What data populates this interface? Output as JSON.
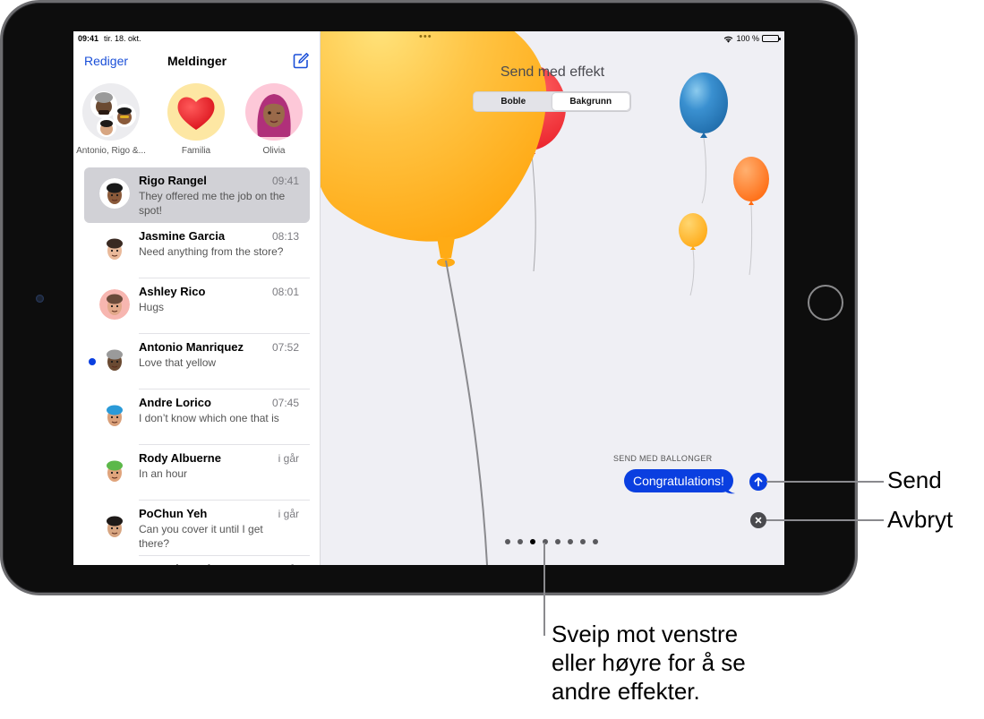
{
  "status_bar": {
    "time": "09:41",
    "date": "tir. 18. okt.",
    "more_dots": "•••",
    "battery_percent": "100 %",
    "battery_level": 1.0
  },
  "sidebar": {
    "edit_label": "Rediger",
    "title": "Meldinger",
    "compose_icon": "compose-icon",
    "pinned": [
      {
        "label": "Antonio, Rigo &...",
        "type": "group",
        "bg": "#ececef"
      },
      {
        "label": "Familia",
        "type": "heart",
        "bg": "#fde7a3"
      },
      {
        "label": "Olivia",
        "type": "memoji",
        "bg": "#fdc8d8"
      }
    ],
    "conversations": [
      {
        "name": "Rigo Rangel",
        "time": "09:41",
        "preview": "They offered me the job on the spot!",
        "selected": true,
        "unread": false,
        "avatar_bg": "#ffffff",
        "skin": "#8a5a3a",
        "hair": "#1a1a1a"
      },
      {
        "name": "Jasmine Garcia",
        "time": "08:13",
        "preview": "Need anything from the store?",
        "selected": false,
        "unread": false,
        "avatar_bg": "#ffffff",
        "skin": "#e9b99a",
        "hair": "#3a2a22"
      },
      {
        "name": "Ashley Rico",
        "time": "08:01",
        "preview": "Hugs",
        "selected": false,
        "unread": false,
        "avatar_bg": "#f7b6b0",
        "skin": "#e2a88a",
        "hair": "#6a4a3a"
      },
      {
        "name": "Antonio Manriquez",
        "time": "07:52",
        "preview": "Love that yellow",
        "selected": false,
        "unread": true,
        "avatar_bg": "#ffffff",
        "skin": "#6a4a32",
        "hair": "#9a9a9a"
      },
      {
        "name": "Andre Lorico",
        "time": "07:45",
        "preview": "I don’t know which one that is",
        "selected": false,
        "unread": false,
        "avatar_bg": "#ffffff",
        "skin": "#d9a07a",
        "hair": "#2a9ad8"
      },
      {
        "name": "Rody Albuerne",
        "time": "i går",
        "preview": "In an hour",
        "selected": false,
        "unread": false,
        "avatar_bg": "#ffffff",
        "skin": "#e0a47c",
        "hair": "#5cb84a"
      },
      {
        "name": "PoChun Yeh",
        "time": "i går",
        "preview": "Can you cover it until I get there?",
        "selected": false,
        "unread": false,
        "avatar_bg": "#ffffff",
        "skin": "#d7a581",
        "hair": "#1e1a18"
      },
      {
        "name": "Manuel Batal",
        "time": "i går",
        "preview": "",
        "selected": false,
        "unread": false,
        "avatar_bg": "#ffffff",
        "skin": "#d7a581",
        "hair": "#1e1a18"
      }
    ]
  },
  "effect": {
    "title": "Send med effekt",
    "tabs": [
      {
        "label": "Boble",
        "active": false
      },
      {
        "label": "Bakgrunn",
        "active": true
      }
    ],
    "effect_name": "SEND MED BALLONGER",
    "message": "Congratulations!",
    "send_icon": "arrow-up-icon",
    "cancel_icon": "close-icon",
    "page_count": 8,
    "current_page": 3,
    "balloon_colors": {
      "yellow": "#ffb51f",
      "red": "#ee1c24",
      "blue": "#2e86c8",
      "orange": "#ff7a1a",
      "small_yellow": "#ffb21f"
    }
  },
  "colors": {
    "accent": "#1a4fd8",
    "bubble": "#0a3fe0",
    "unread": "#0a3fe0",
    "screen_bg": "#efeff4"
  },
  "callouts": {
    "send": "Send",
    "cancel": "Avbryt",
    "swipe": "Sveip mot venstre eller høyre for å se andre effekter.",
    "swipe_lines": [
      "Sveip mot venstre",
      "eller høyre for å se",
      "andre effekter."
    ]
  }
}
